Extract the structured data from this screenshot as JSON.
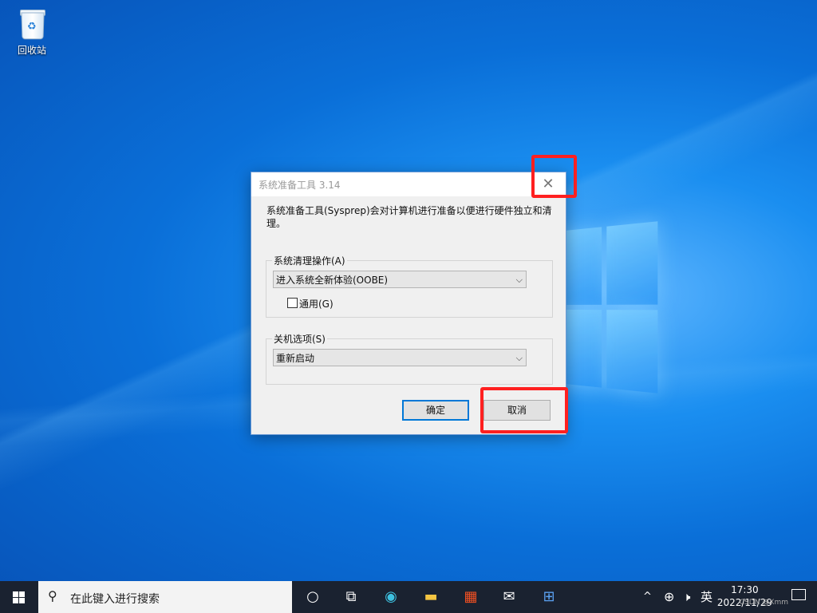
{
  "desktop": {
    "recycle_bin_label": "回收站"
  },
  "dialog": {
    "title": "系统准备工具 3.14",
    "description": "系统准备工具(Sysprep)会对计算机进行准备以便进行硬件独立和清理。",
    "cleanup_group_label": "系统清理操作(A)",
    "cleanup_selected": "进入系统全新体验(OOBE)",
    "generalize_label": "通用(G)",
    "generalize_checked": false,
    "shutdown_group_label": "关机选项(S)",
    "shutdown_selected": "重新启动",
    "ok_label": "确定",
    "cancel_label": "取消"
  },
  "taskbar": {
    "search_placeholder": "在此键入进行搜索",
    "ime": "英",
    "time": "17:30",
    "date": "2022/11/29",
    "watermark": "CSDN @Xmm"
  },
  "colors": {
    "highlight": "#ff2020",
    "taskbar_bg": "#1a2230",
    "accent": "#0078d7"
  }
}
